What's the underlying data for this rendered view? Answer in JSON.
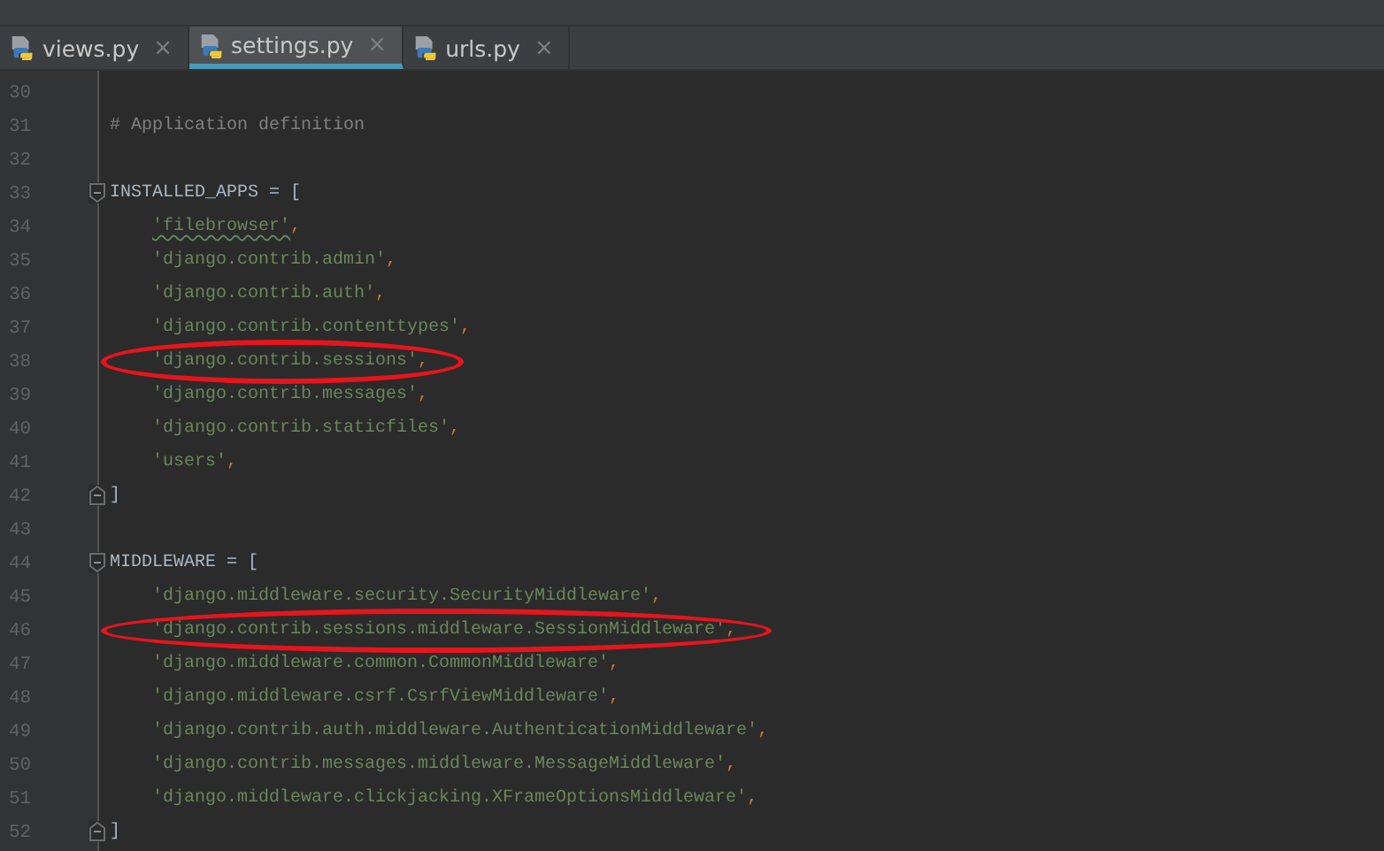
{
  "tabs": [
    {
      "label": "views.py",
      "selected": false,
      "close": "×"
    },
    {
      "label": "settings.py",
      "selected": true,
      "close": "×"
    },
    {
      "label": "urls.py",
      "selected": false,
      "close": "×"
    }
  ],
  "lines": [
    {
      "num": "30"
    },
    {
      "num": "31",
      "tokens": [
        {
          "kind": "comment",
          "text": "# Application definition"
        }
      ]
    },
    {
      "num": "32"
    },
    {
      "num": "33",
      "fold_open": true,
      "tokens": [
        {
          "kind": "plain",
          "text": "INSTALLED_APPS = ["
        }
      ]
    },
    {
      "num": "34",
      "indented": true,
      "tokens": [
        {
          "kind": "string",
          "text": "'filebrowser'",
          "typo": true
        },
        {
          "kind": "punct",
          "text": ","
        }
      ]
    },
    {
      "num": "35",
      "indented": true,
      "tokens": [
        {
          "kind": "string",
          "text": "'django.contrib.admin'"
        },
        {
          "kind": "punct",
          "text": ","
        }
      ]
    },
    {
      "num": "36",
      "indented": true,
      "tokens": [
        {
          "kind": "string",
          "text": "'django.contrib.auth'"
        },
        {
          "kind": "punct",
          "text": ","
        }
      ]
    },
    {
      "num": "37",
      "indented": true,
      "tokens": [
        {
          "kind": "string",
          "text": "'django.contrib.contenttypes'"
        },
        {
          "kind": "punct",
          "text": ","
        }
      ]
    },
    {
      "num": "38",
      "indented": true,
      "circled": true,
      "tokens": [
        {
          "kind": "string",
          "text": "'django.contrib.sessions'"
        },
        {
          "kind": "punct",
          "text": ","
        }
      ]
    },
    {
      "num": "39",
      "indented": true,
      "tokens": [
        {
          "kind": "string",
          "text": "'django.contrib.messages'"
        },
        {
          "kind": "punct",
          "text": ","
        }
      ]
    },
    {
      "num": "40",
      "indented": true,
      "tokens": [
        {
          "kind": "string",
          "text": "'django.contrib.staticfiles'"
        },
        {
          "kind": "punct",
          "text": ","
        }
      ]
    },
    {
      "num": "41",
      "indented": true,
      "tokens": [
        {
          "kind": "string",
          "text": "'users'"
        },
        {
          "kind": "punct",
          "text": ","
        }
      ]
    },
    {
      "num": "42",
      "fold_close": true,
      "tokens": [
        {
          "kind": "plain",
          "text": "]"
        }
      ]
    },
    {
      "num": "43"
    },
    {
      "num": "44",
      "fold_open": true,
      "tokens": [
        {
          "kind": "plain",
          "text": "MIDDLEWARE = ["
        }
      ]
    },
    {
      "num": "45",
      "indented": true,
      "tokens": [
        {
          "kind": "string",
          "text": "'django.middleware.security.SecurityMiddleware'"
        },
        {
          "kind": "punct",
          "text": ","
        }
      ]
    },
    {
      "num": "46",
      "indented": true,
      "circled": true,
      "tokens": [
        {
          "kind": "string",
          "text": "'django.contrib.sessions.middleware.SessionMiddleware'"
        },
        {
          "kind": "punct",
          "text": ","
        }
      ]
    },
    {
      "num": "47",
      "indented": true,
      "tokens": [
        {
          "kind": "string",
          "text": "'django.middleware.common.CommonMiddleware'"
        },
        {
          "kind": "punct",
          "text": ","
        }
      ]
    },
    {
      "num": "48",
      "indented": true,
      "tokens": [
        {
          "kind": "string",
          "text": "'django.middleware.csrf.CsrfViewMiddleware'"
        },
        {
          "kind": "punct",
          "text": ","
        }
      ]
    },
    {
      "num": "49",
      "indented": true,
      "tokens": [
        {
          "kind": "string",
          "text": "'django.contrib.auth.middleware.AuthenticationMiddleware'"
        },
        {
          "kind": "punct",
          "text": ","
        }
      ]
    },
    {
      "num": "50",
      "indented": true,
      "tokens": [
        {
          "kind": "string",
          "text": "'django.contrib.messages.middleware.MessageMiddleware'"
        },
        {
          "kind": "punct",
          "text": ","
        }
      ]
    },
    {
      "num": "51",
      "indented": true,
      "tokens": [
        {
          "kind": "string",
          "text": "'django.middleware.clickjacking.XFrameOptionsMiddleware'"
        },
        {
          "kind": "punct",
          "text": ","
        }
      ]
    },
    {
      "num": "52",
      "fold_close": true,
      "tokens": [
        {
          "kind": "plain",
          "text": "]"
        }
      ]
    }
  ]
}
